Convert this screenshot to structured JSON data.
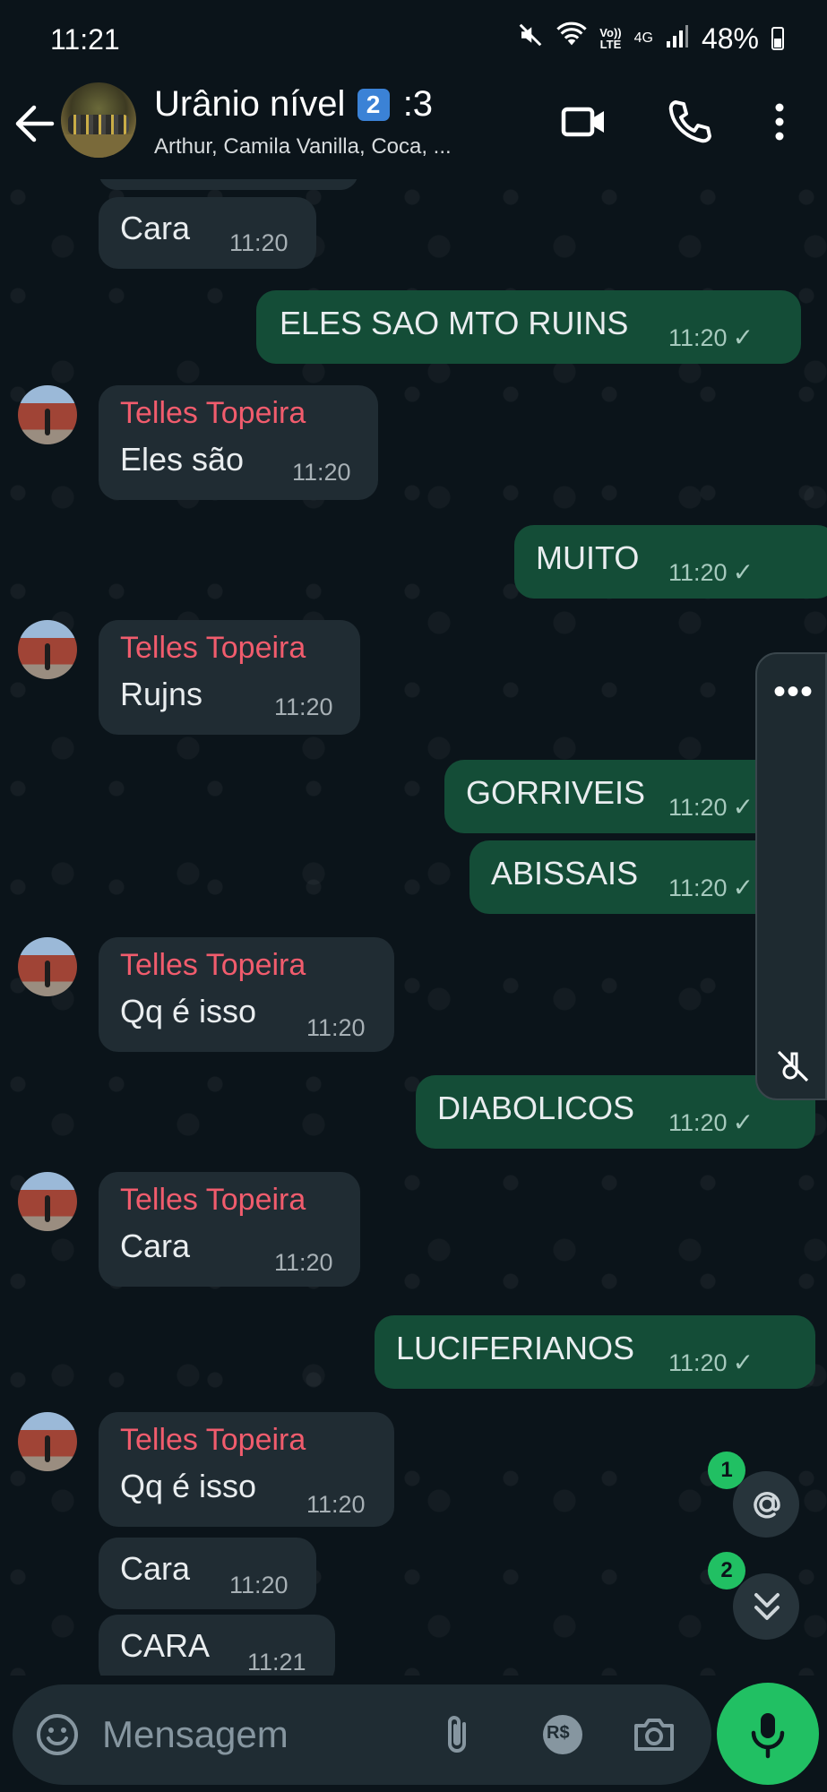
{
  "status_bar": {
    "time": "11:21",
    "volte_top": "Vo))",
    "volte_bottom": "LTE",
    "network": "4G",
    "battery": "48%"
  },
  "header": {
    "title_before_badge": "Urânio nível",
    "title_badge": "2",
    "title_after_badge": ":3",
    "subtitle": "Arthur, Camila Vanilla, Coca, ..."
  },
  "messages": [
    {
      "dir": "in",
      "text": "Cara",
      "time": "11:20"
    },
    {
      "dir": "out",
      "text": "ELES SAO MTO RUINS",
      "time": "11:20",
      "status": "✓"
    },
    {
      "dir": "in",
      "sender": "Telles Topeira",
      "text": "Eles são",
      "time": "11:20"
    },
    {
      "dir": "out",
      "text": "MUITO",
      "time": "11:20",
      "status": "✓"
    },
    {
      "dir": "in",
      "sender": "Telles Topeira",
      "text": "Rujns",
      "time": "11:20"
    },
    {
      "dir": "out",
      "text": "GORRIVEIS",
      "time": "11:20",
      "status": "✓"
    },
    {
      "dir": "out",
      "text": "ABISSAIS",
      "time": "11:20",
      "status": "✓"
    },
    {
      "dir": "in",
      "sender": "Telles Topeira",
      "text": "Qq é isso",
      "time": "11:20"
    },
    {
      "dir": "out",
      "text": "DIABOLICOS",
      "time": "11:20",
      "status": "✓"
    },
    {
      "dir": "in",
      "sender": "Telles Topeira",
      "text": "Cara",
      "time": "11:20"
    },
    {
      "dir": "out",
      "text": "LUCIFERIANOS",
      "time": "11:20",
      "status": "✓"
    },
    {
      "dir": "in",
      "sender": "Telles Topeira",
      "text": "Qq é isso",
      "time": "11:20"
    },
    {
      "dir": "in",
      "text": "Cara",
      "time": "11:20"
    },
    {
      "dir": "in",
      "text": "CARA",
      "time": "11:21"
    }
  ],
  "floating": {
    "mentions_count": "1",
    "unread_count": "2",
    "side_menu": "•••"
  },
  "input": {
    "placeholder": "Mensagem",
    "currency_label": "R$"
  },
  "colors": {
    "background": "#0b141a",
    "incoming_bubble": "#202c33",
    "outgoing_bubble": "#144d37",
    "sender_name": "#f15c6d",
    "accent_green": "#21c063"
  },
  "icons": {
    "back": "arrow-left-icon",
    "video": "video-call-icon",
    "phone": "phone-call-icon",
    "menu": "more-vertical-icon",
    "emoji": "emoji-icon",
    "attach": "paperclip-icon",
    "payment": "payment-icon",
    "camera": "camera-icon",
    "mic": "microphone-icon",
    "mention": "at-sign-icon",
    "scroll_down": "double-chevron-down-icon",
    "mute": "mute-icon"
  }
}
